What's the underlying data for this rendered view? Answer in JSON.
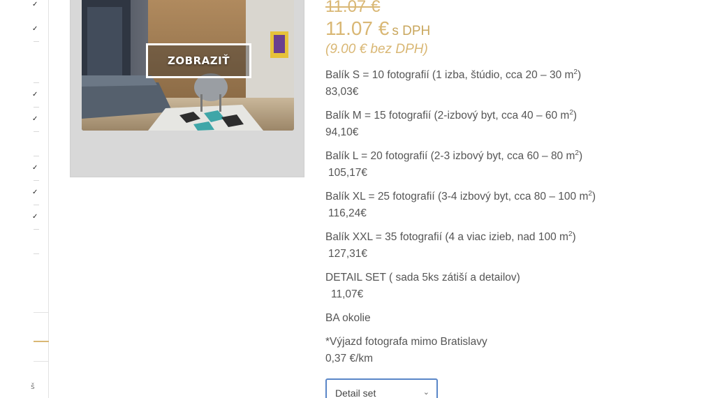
{
  "sidebar": {
    "check_glyph": "✓",
    "bottom_glyph": "š"
  },
  "product": {
    "image_button": "ZOBRAZIŤ",
    "price_old": "11.07 €",
    "price_current": "11.07 €",
    "price_current_suffix": "s DPH",
    "price_net": "(9.00 € bez DPH)"
  },
  "packages": [
    {
      "label": "Balík S = 10 fotografií (1 izba, štúdio, cca 20 – 30 m",
      "sup": "2",
      "close": ")",
      "price": "83,03€"
    },
    {
      "label": "Balík M = 15 fotografií (2-izbový byt, cca 40 – 60 m",
      "sup": "2",
      "close": ")",
      "price": "94,10€"
    },
    {
      "label": "Balík L = 20 fotografií (2-3 izbový byt, cca 60 – 80 m",
      "sup": "2",
      "close": ")",
      "price": "105,17€"
    },
    {
      "label": "Balík XL = 25 fotografií (3-4 izbový byt, cca 80 – 100 m",
      "sup": "2",
      "close": ")",
      "price": "116,24€"
    },
    {
      "label": "Balík XXL = 35 fotografií (4 a viac izieb, nad 100 m",
      "sup": "2",
      "close": ")",
      "price": "127,31€"
    }
  ],
  "detail_set": {
    "label": "DETAIL SET ( sada 5ks zátiší a detailov)",
    "price": "11,07€"
  },
  "area": "BA okolie",
  "travel": {
    "label": "*Výjazd fotografa mimo Bratislavy",
    "price": "0,37 €/km"
  },
  "variant_select": {
    "value": "Detail set",
    "chevron": "⌄"
  },
  "colors": {
    "accent_gold": "#d9b774",
    "text": "#555555",
    "select_border": "#5a86c8"
  }
}
